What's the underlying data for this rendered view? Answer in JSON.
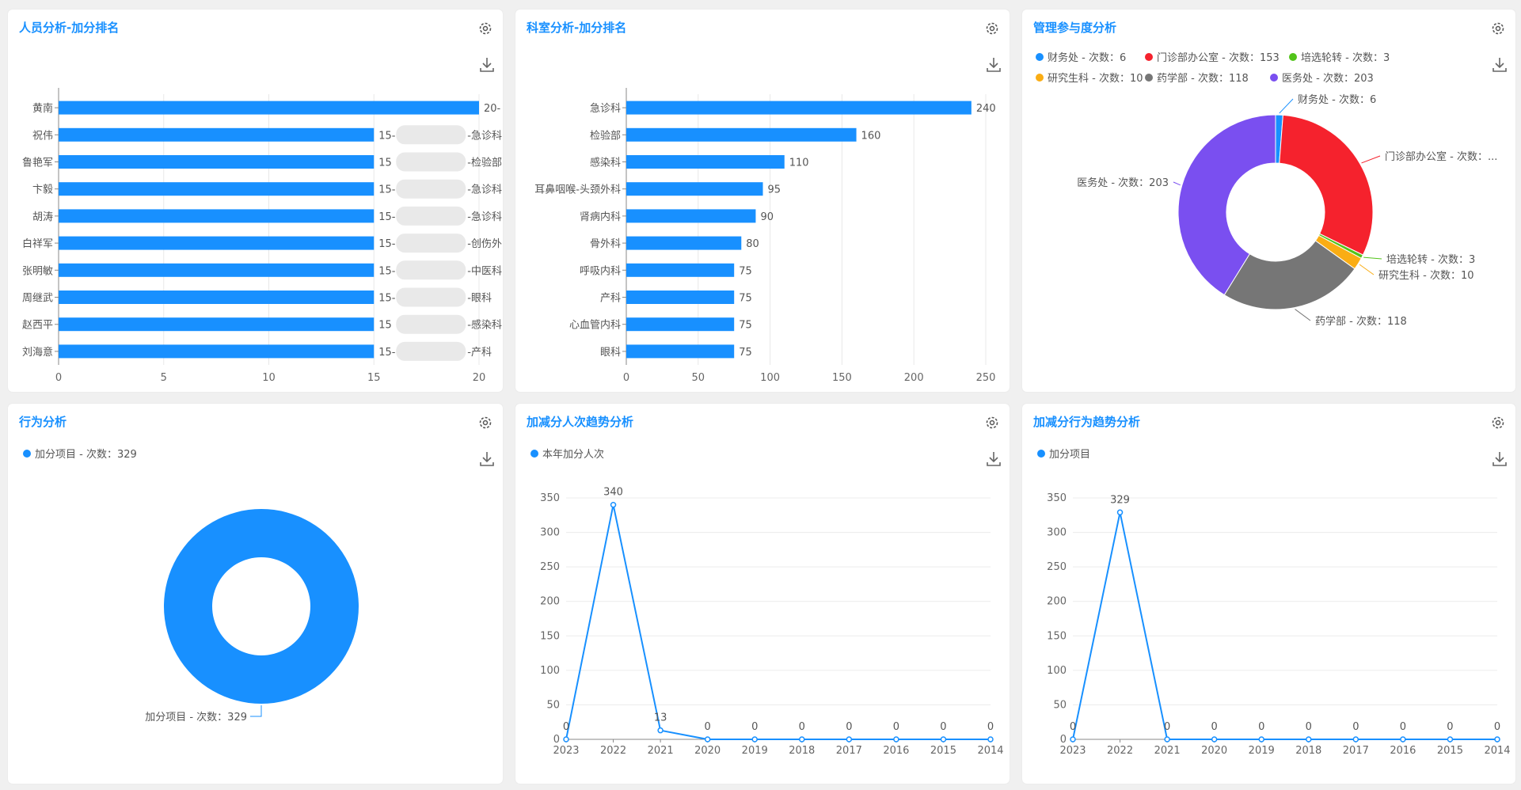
{
  "colors": {
    "accent": "#1890ff",
    "pie_red": "#f5222d",
    "pie_green": "#52c41a",
    "pie_orange": "#faad14",
    "pie_gray": "#767676",
    "pie_purple": "#7a4ff0"
  },
  "icons": {
    "settings": "gear-icon",
    "download": "download-icon"
  },
  "panels": [
    {
      "title": "人员分析-加分排名"
    },
    {
      "title": "科室分析-加分排名"
    },
    {
      "title": "管理参与度分析"
    },
    {
      "title": "行为分析"
    },
    {
      "title": "加减分人次趋势分析"
    },
    {
      "title": "加减分行为趋势分析"
    }
  ],
  "chart_data": [
    {
      "type": "bar",
      "orientation": "horizontal",
      "categories": [
        "黄南",
        "祝伟",
        "鲁艳军",
        "卞毅",
        "胡涛",
        "白祥军",
        "张明敏",
        "周继武",
        "赵西平",
        "刘海意"
      ],
      "values": [
        20,
        15,
        15,
        15,
        15,
        15,
        15,
        15,
        15,
        15
      ],
      "data_labels": [
        "20-",
        "15-",
        "15",
        "15-",
        "15-",
        "15-",
        "15-",
        "15-",
        "15",
        "15-"
      ],
      "data_label_suffixes": [
        "",
        "急诊科",
        "检验部",
        "急诊科",
        "急诊科",
        "创伤外",
        "中医科",
        "眼科",
        "感染科",
        "产科"
      ],
      "xlim": [
        0,
        20
      ],
      "xticks": [
        "0",
        "5",
        "10",
        "15",
        "20"
      ]
    },
    {
      "type": "bar",
      "orientation": "horizontal",
      "categories": [
        "急诊科",
        "检验部",
        "感染科",
        "耳鼻咽喉-头颈外科",
        "肾病内科",
        "骨外科",
        "呼吸内科",
        "产科",
        "心血管内科",
        "眼科"
      ],
      "values": [
        240,
        160,
        110,
        95,
        90,
        80,
        75,
        75,
        75,
        75
      ],
      "xlim": [
        0,
        250
      ],
      "xticks": [
        "0",
        "50",
        "100",
        "150",
        "200",
        "250"
      ]
    },
    {
      "type": "pie",
      "donut": true,
      "legend_position": "top",
      "series": [
        {
          "name": "财务处",
          "label": "财务处 - 次数：6",
          "value": 6,
          "color": "#1890ff"
        },
        {
          "name": "门诊部办公室",
          "label": "门诊部办公室 - 次数：153",
          "value": 153,
          "color": "#f5222d"
        },
        {
          "name": "培选轮转",
          "label": "培选轮转 - 次数：3",
          "value": 3,
          "color": "#52c41a"
        },
        {
          "name": "研究生科",
          "label": "研究生科 - 次数：10",
          "value": 10,
          "color": "#faad14"
        },
        {
          "name": "药学部",
          "label": "药学部 - 次数：118",
          "value": 118,
          "color": "#767676"
        },
        {
          "name": "医务处",
          "label": "医务处 - 次数：203",
          "value": 203,
          "color": "#7a4ff0"
        }
      ],
      "slice_labels": [
        "财务处 - 次数：6",
        "门诊部办公室 - 次数：...",
        "培选轮转 - 次数：3",
        "研究生科 - 次数：10",
        "药学部 - 次数：118",
        "医务处 - 次数：203"
      ]
    },
    {
      "type": "pie",
      "donut": true,
      "legend_position": "top-left",
      "series": [
        {
          "name": "加分项目",
          "label": "加分项目 - 次数：329",
          "value": 329,
          "color": "#1890ff"
        }
      ],
      "slice_labels": [
        "加分项目 - 次数：329"
      ]
    },
    {
      "type": "line",
      "legend_position": "top-left",
      "x": [
        "2023",
        "2022",
        "2021",
        "2020",
        "2019",
        "2018",
        "2017",
        "2016",
        "2015",
        "2014"
      ],
      "series": [
        {
          "name": "本年加分人次",
          "values": [
            0,
            340,
            13,
            0,
            0,
            0,
            0,
            0,
            0,
            0
          ]
        }
      ],
      "ylim": [
        0,
        350
      ],
      "yticks": [
        "0",
        "50",
        "100",
        "150",
        "200",
        "250",
        "300",
        "350"
      ]
    },
    {
      "type": "line",
      "legend_position": "top-left",
      "x": [
        "2023",
        "2022",
        "2021",
        "2020",
        "2019",
        "2018",
        "2017",
        "2016",
        "2015",
        "2014"
      ],
      "series": [
        {
          "name": "加分项目",
          "values": [
            0,
            329,
            0,
            0,
            0,
            0,
            0,
            0,
            0,
            0
          ]
        }
      ],
      "ylim": [
        0,
        350
      ],
      "yticks": [
        "0",
        "50",
        "100",
        "150",
        "200",
        "250",
        "300",
        "350"
      ]
    }
  ]
}
